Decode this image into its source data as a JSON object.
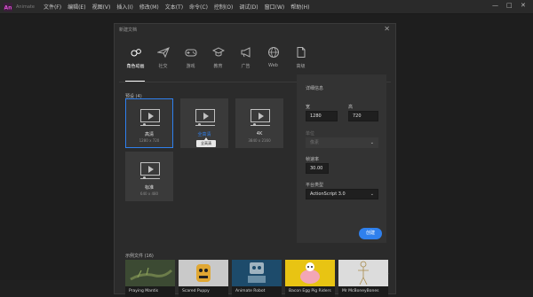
{
  "app": {
    "name": "Animate",
    "logo_letter": "An",
    "logo_color": "#d94fd1"
  },
  "menubar": {
    "items": [
      "文件(F)",
      "编辑(E)",
      "视图(V)",
      "插入(I)",
      "修改(M)",
      "文本(T)",
      "命令(C)",
      "控制(O)",
      "调试(D)",
      "窗口(W)",
      "帮助(H)"
    ],
    "minimize": "—",
    "maximize": "□",
    "close": "✕"
  },
  "dialog": {
    "title": "新建文档",
    "close": "✕",
    "tabs": [
      {
        "label": "角色动画",
        "icon": "character-animation-icon",
        "active": true
      },
      {
        "label": "社交",
        "icon": "paper-plane-icon"
      },
      {
        "label": "游戏",
        "icon": "gamepad-icon"
      },
      {
        "label": "教育",
        "icon": "graduation-cap-icon"
      },
      {
        "label": "广告",
        "icon": "megaphone-icon"
      },
      {
        "label": "Web",
        "icon": "globe-icon"
      },
      {
        "label": "高级",
        "icon": "document-icon"
      }
    ],
    "presets_label": "预设 (4)",
    "presets": [
      {
        "name": "高清",
        "size": "1280 x 720",
        "selected": true
      },
      {
        "name": "全高清",
        "size": "",
        "highlight": true
      },
      {
        "name": "4K",
        "size": "3840 x 2160"
      },
      {
        "name": "标准",
        "size": "640 x 480"
      }
    ],
    "tooltip": "全高清",
    "details": {
      "title": "详细信息",
      "width_label": "宽",
      "width_value": "1280",
      "height_label": "高",
      "height_value": "720",
      "unit_label": "单位",
      "unit_value": "像素",
      "fps_label": "帧速率",
      "fps_value": "30.00",
      "platform_label": "平台类型",
      "platform_value": "ActionScript 3.0",
      "create_label": "创建"
    },
    "samples_label": "示例文件 (16)",
    "samples": [
      {
        "caption": "Praying Mantis",
        "color": "#3c4a33"
      },
      {
        "caption": "Scared Puppy",
        "color": "#c9c9c9"
      },
      {
        "caption": "Animate Robot",
        "color": "#1d4b6b"
      },
      {
        "caption": "Bacon Egg Pig Riders",
        "color": "#e8c413"
      },
      {
        "caption": "Mr McBoneyBones",
        "color": "#dcdcdc"
      }
    ],
    "next_arrow": "›"
  }
}
